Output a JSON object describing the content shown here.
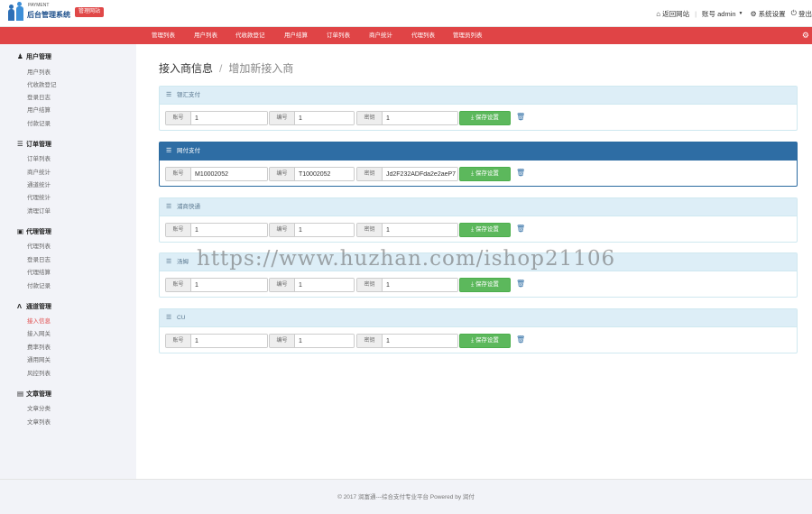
{
  "header": {
    "brand_small": "PAYMENT",
    "brand": "后台管理系统",
    "badge": "管理网站",
    "home_label": "返回网站",
    "account_label": "账号 admin",
    "settings_label": "系统设置",
    "logout_label": "登出"
  },
  "nav": {
    "items": [
      "管理列表",
      "用户列表",
      "代收款登记",
      "用户结算",
      "订单列表",
      "商户统计",
      "代理列表",
      "管理员列表"
    ]
  },
  "sidebar": {
    "groups": [
      {
        "title": "用户管理",
        "icon": "user-icon",
        "items": [
          "用户列表",
          "代收款登记",
          "登录日志",
          "用户结算",
          "付款记录"
        ]
      },
      {
        "title": "订单管理",
        "icon": "list-icon",
        "items": [
          "订单列表",
          "商户统计",
          "通道统计",
          "代理统计",
          "清理订单"
        ]
      },
      {
        "title": "代理管理",
        "icon": "briefcase-icon",
        "items": [
          "代理列表",
          "登录日志",
          "代理结算",
          "付款记录"
        ]
      },
      {
        "title": "通道管理",
        "icon": "road-icon",
        "items": [
          "接入信息",
          "接入网关",
          "费率列表",
          "通用网关",
          "风控列表"
        ]
      },
      {
        "title": "文章管理",
        "icon": "book-icon",
        "items": [
          "文章分类",
          "文章列表"
        ]
      }
    ],
    "active_item": "接入信息"
  },
  "breadcrumb": {
    "title": "接入商信息",
    "separator": "/",
    "link": "增加新接入商"
  },
  "panels": [
    {
      "title": "银汇支付",
      "active": false,
      "account_label": "账号",
      "account_value": "1",
      "code_label": "编号",
      "code_value": "1",
      "key_label": "密钥",
      "key_value": "1",
      "button": "保存设置"
    },
    {
      "title": "网付支付",
      "active": true,
      "account_label": "账号",
      "account_value": "M10002052",
      "code_label": "编号",
      "code_value": "T10002052",
      "key_label": "密钥",
      "key_value": "Jd2F232ADFda2e2aeP7",
      "button": "保存设置"
    },
    {
      "title": "浦商快通",
      "active": false,
      "account_label": "账号",
      "account_value": "1",
      "code_label": "编号",
      "code_value": "1",
      "key_label": "密钥",
      "key_value": "1",
      "button": "保存设置"
    },
    {
      "title": "汤姆",
      "active": false,
      "account_label": "账号",
      "account_value": "1",
      "code_label": "编号",
      "code_value": "1",
      "key_label": "密钥",
      "key_value": "1",
      "button": "保存设置"
    },
    {
      "title": "CU",
      "active": false,
      "account_label": "账号",
      "account_value": "1",
      "code_label": "编号",
      "code_value": "1",
      "key_label": "密钥",
      "key_value": "1",
      "button": "保存设置"
    }
  ],
  "watermark": "https://www.huzhan.com/ishop21106",
  "footer": "© 2017 润富通---综合支付专业平台 Powered by 润付",
  "colors": {
    "nav_red": "#e04446",
    "panel_blue": "#2e6da4",
    "save_green": "#5cb85c",
    "sidebar_bg": "#f2f3f8"
  }
}
